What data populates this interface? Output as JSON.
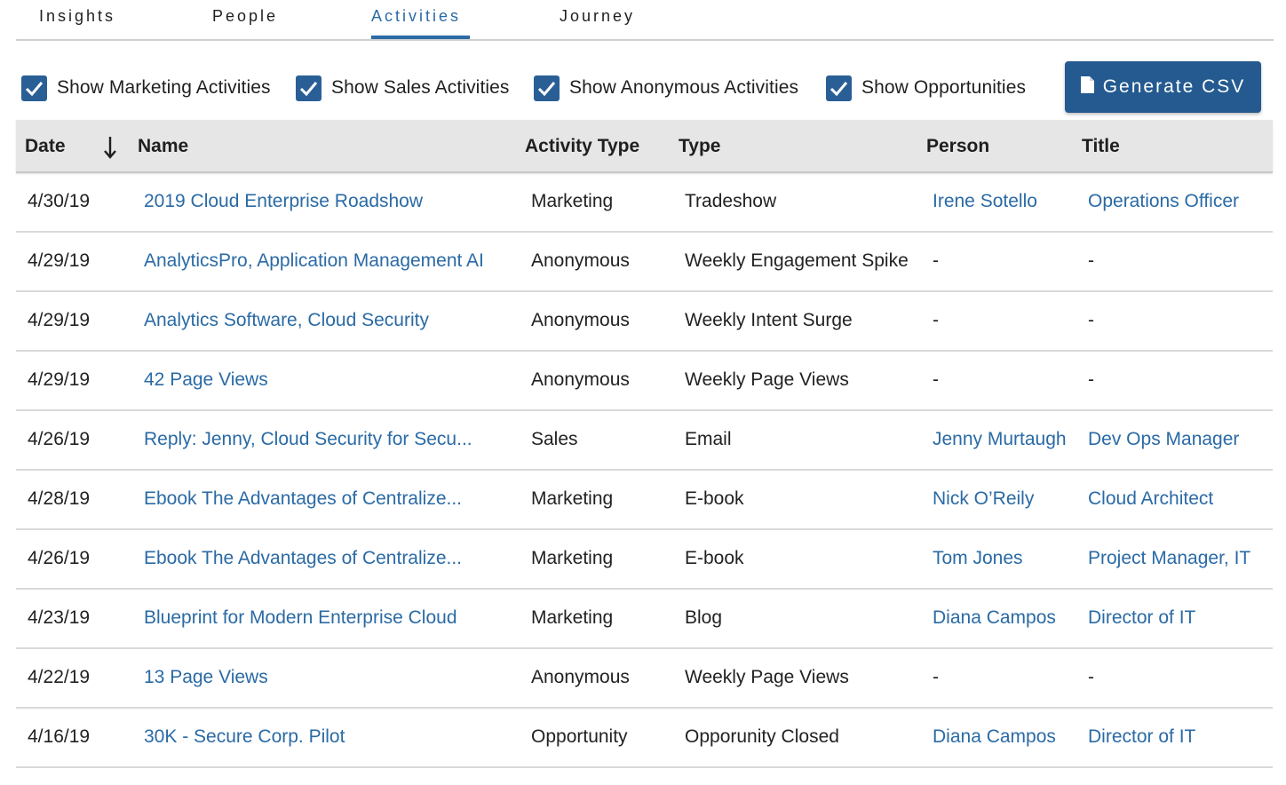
{
  "tabs": [
    {
      "label": "Insights",
      "active": false
    },
    {
      "label": "People",
      "active": false
    },
    {
      "label": "Activities",
      "active": true
    },
    {
      "label": "Journey",
      "active": false
    }
  ],
  "filters": [
    {
      "label": "Show Marketing Activities",
      "checked": true
    },
    {
      "label": "Show Sales Activities",
      "checked": true
    },
    {
      "label": "Show Anonymous Activities",
      "checked": true
    },
    {
      "label": "Show Opportunities",
      "checked": true
    }
  ],
  "generate_csv": {
    "label": "Generate CSV",
    "icon": "file-icon"
  },
  "table": {
    "columns": [
      "Date",
      "Name",
      "Activity Type",
      "Type",
      "Person",
      "Title"
    ],
    "sort": {
      "column": "Date",
      "direction": "descending",
      "icon": "arrow-down-icon"
    },
    "rows": [
      {
        "date": "4/30/19",
        "name": "2019 Cloud Enterprise Roadshow",
        "activity_type": "Marketing",
        "type": "Tradeshow",
        "person": "Irene Sotello",
        "title": "Operations Officer"
      },
      {
        "date": "4/29/19",
        "name": "AnalyticsPro, Application Management AI",
        "activity_type": "Anonymous",
        "type": "Weekly Engagement Spike",
        "person": "-",
        "title": "-"
      },
      {
        "date": "4/29/19",
        "name": "Analytics Software, Cloud Security",
        "activity_type": "Anonymous",
        "type": "Weekly Intent Surge",
        "person": "-",
        "title": "-"
      },
      {
        "date": "4/29/19",
        "name": "42 Page Views",
        "activity_type": "Anonymous",
        "type": "Weekly Page Views",
        "person": "-",
        "title": "-"
      },
      {
        "date": "4/26/19",
        "name": "Reply: Jenny, Cloud Security for Secu...",
        "activity_type": "Sales",
        "type": "Email",
        "person": "Jenny Murtaugh",
        "title": "Dev Ops Manager"
      },
      {
        "date": "4/28/19",
        "name": "Ebook The Advantages of Centralize...",
        "activity_type": "Marketing",
        "type": "E-book",
        "person": "Nick O’Reily",
        "title": "Cloud Architect"
      },
      {
        "date": "4/26/19",
        "name": "Ebook The Advantages of Centralize...",
        "activity_type": "Marketing",
        "type": "E-book",
        "person": "Tom Jones",
        "title": "Project Manager, IT"
      },
      {
        "date": "4/23/19",
        "name": "Blueprint for Modern Enterprise Cloud",
        "activity_type": "Marketing",
        "type": "Blog",
        "person": "Diana Campos",
        "title": "Director of IT"
      },
      {
        "date": "4/22/19",
        "name": "13 Page Views",
        "activity_type": "Anonymous",
        "type": "Weekly Page Views",
        "person": "-",
        "title": "-"
      },
      {
        "date": "4/16/19",
        "name": "30K - Secure Corp. Pilot",
        "activity_type": "Opportunity",
        "type": "Opporunity Closed",
        "person": "Diana Campos",
        "title": "Director of IT"
      }
    ]
  },
  "colors": {
    "accent": "#2a6aa5",
    "button": "#245a8f",
    "checkbox": "#2a5f96",
    "header_bg": "#e6e6e6"
  }
}
